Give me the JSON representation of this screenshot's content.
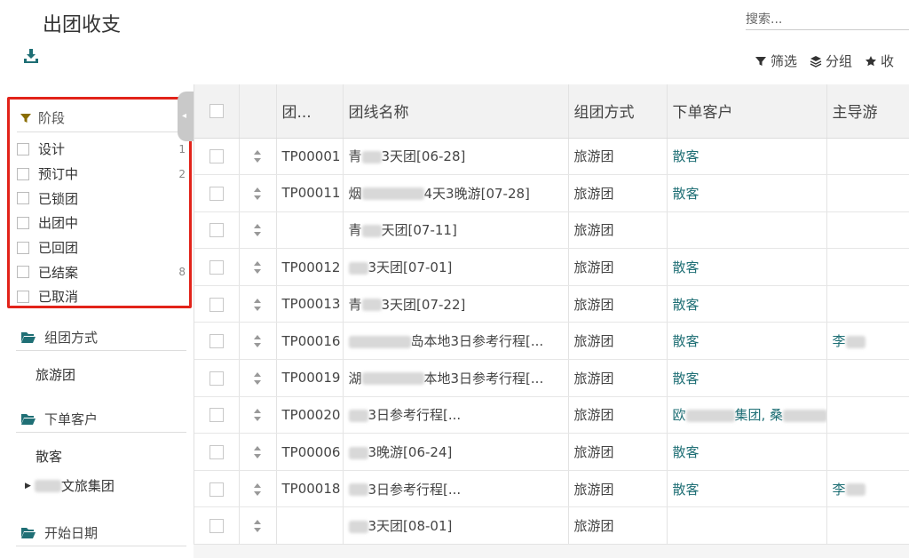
{
  "header": {
    "title": "出团收支",
    "search_placeholder": "搜索...",
    "toolbar": {
      "filter": "筛选",
      "group": "分组",
      "favorite": "收"
    }
  },
  "sidebar": {
    "stage_facet": {
      "title": "阶段",
      "items": [
        {
          "label": "设计",
          "count": "1"
        },
        {
          "label": "预订中",
          "count": "2"
        },
        {
          "label": "已锁团",
          "count": ""
        },
        {
          "label": "出团中",
          "count": ""
        },
        {
          "label": "已回团",
          "count": ""
        },
        {
          "label": "已结案",
          "count": "8"
        },
        {
          "label": "已取消",
          "count": ""
        }
      ]
    },
    "groups": [
      {
        "title": "组团方式",
        "items": [
          "旅游团"
        ]
      },
      {
        "title": "下单客户",
        "items": [
          "散客",
          "文旅集团"
        ]
      },
      {
        "title": "开始日期",
        "items": []
      }
    ]
  },
  "table": {
    "columns": [
      "",
      "",
      "团...",
      "团线名称",
      "组团方式",
      "下单客户",
      "主导游"
    ],
    "rows": [
      {
        "code": "TP00001",
        "name_prefix": "青",
        "name": "3天团[06-28]",
        "mode": "旅游团",
        "customer": "散客",
        "customer_suffix": "",
        "guide": ""
      },
      {
        "code": "TP00011",
        "name_prefix": "烟",
        "name": "4天3晚游[07-28]",
        "mode": "旅游团",
        "customer": "散客",
        "customer_suffix": "",
        "guide": ""
      },
      {
        "code": "",
        "name_prefix": "青",
        "name": "天团[07-11]",
        "mode": "旅游团",
        "customer": "",
        "customer_suffix": "",
        "guide": ""
      },
      {
        "code": "TP00012",
        "name_prefix": "",
        "name": "3天团[07-01]",
        "mode": "旅游团",
        "customer": "散客",
        "customer_suffix": "",
        "guide": ""
      },
      {
        "code": "TP00013",
        "name_prefix": "青",
        "name": "3天团[07-22]",
        "mode": "旅游团",
        "customer": "散客",
        "customer_suffix": "",
        "guide": ""
      },
      {
        "code": "TP00016",
        "name_prefix": "",
        "name": "岛本地3日参考行程[...",
        "mode": "旅游团",
        "customer": "散客",
        "customer_suffix": "",
        "guide": "李"
      },
      {
        "code": "TP00019",
        "name_prefix": "湖",
        "name": "本地3日参考行程[...",
        "mode": "旅游团",
        "customer": "散客",
        "customer_suffix": "",
        "guide": ""
      },
      {
        "code": "TP00020",
        "name_prefix": "",
        "name": "3日参考行程[...",
        "mode": "旅游团",
        "customer": "欧",
        "customer_suffix": "集团, 桑",
        "guide": ""
      },
      {
        "code": "TP00006",
        "name_prefix": "",
        "name": "3晚游[06-24]",
        "mode": "旅游团",
        "customer": "散客",
        "customer_suffix": "",
        "guide": ""
      },
      {
        "code": "TP00018",
        "name_prefix": "",
        "name": "3日参考行程[...",
        "mode": "旅游团",
        "customer": "散客",
        "customer_suffix": "",
        "guide": "李"
      },
      {
        "code": "",
        "name_prefix": "",
        "name": "3天团[08-01]",
        "mode": "旅游团",
        "customer": "",
        "customer_suffix": "",
        "guide": ""
      }
    ]
  },
  "colors": {
    "accent": "#1f6f75",
    "highlight": "#e2231a",
    "filter_icon": "#8a6d00"
  }
}
